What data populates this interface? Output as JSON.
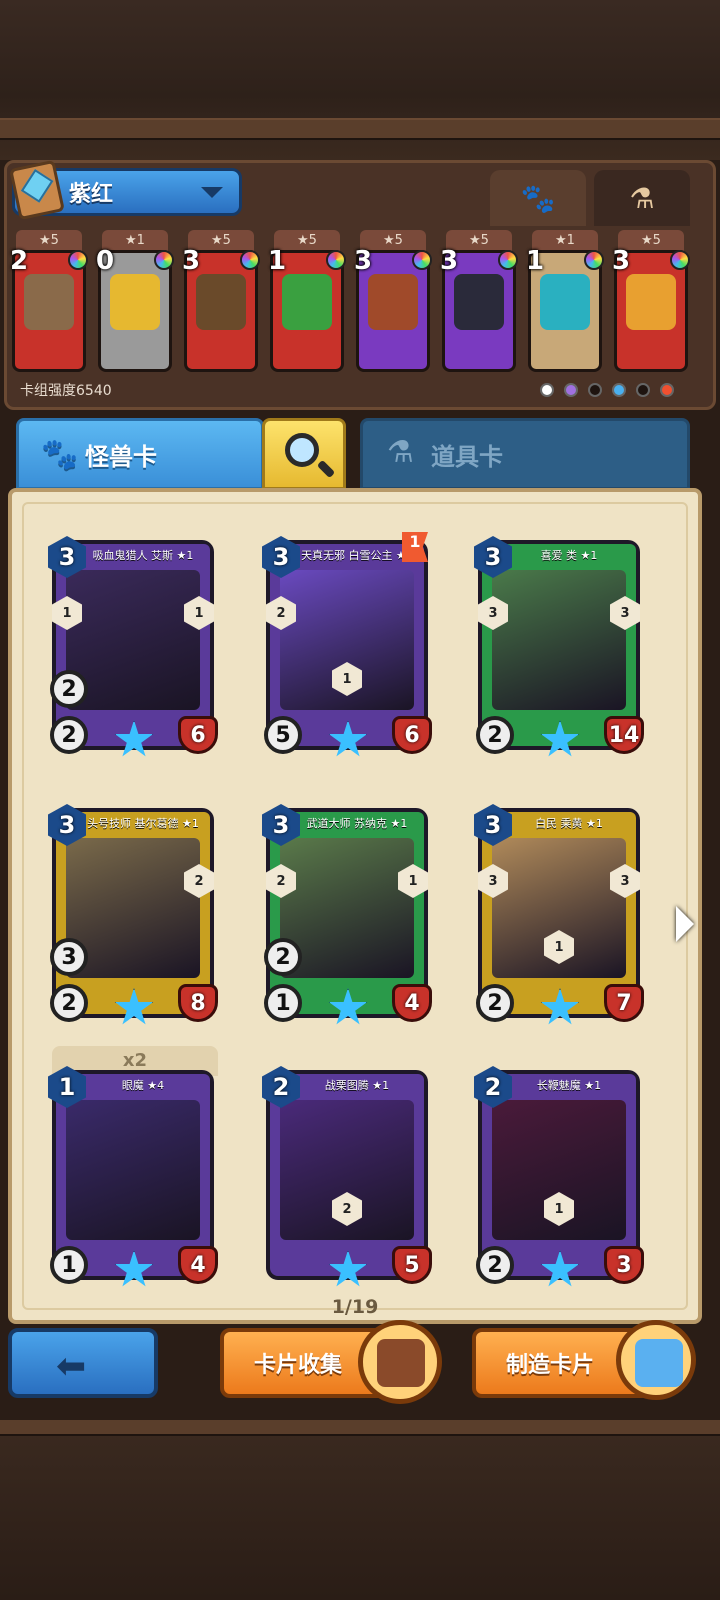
{
  "header": {
    "deck_name": "紫红",
    "top_tabs": [
      {
        "icon": "paw-icon",
        "active": false
      },
      {
        "icon": "potion-icon",
        "active": true
      }
    ]
  },
  "deck": {
    "strength_label": "卡组强度6540",
    "cards": [
      {
        "stars": "★5",
        "cost": "2",
        "frame_color": "#c8322a",
        "art_color": "#8a6a4a"
      },
      {
        "stars": "★1",
        "cost": "0",
        "frame_color": "#9a9a9a",
        "art_color": "#e6b830"
      },
      {
        "stars": "★5",
        "cost": "3",
        "frame_color": "#c8322a",
        "art_color": "#6a4a2a"
      },
      {
        "stars": "★5",
        "cost": "1",
        "frame_color": "#c8322a",
        "art_color": "#3aa040"
      },
      {
        "stars": "★5",
        "cost": "3",
        "frame_color": "#7a3ac0",
        "art_color": "#a04a2a"
      },
      {
        "stars": "★5",
        "cost": "3",
        "frame_color": "#7a3ac0",
        "art_color": "#2a2a3a"
      },
      {
        "stars": "★1",
        "cost": "1",
        "frame_color": "#c8a878",
        "art_color": "#2ab0c0"
      },
      {
        "stars": "★5",
        "cost": "3",
        "frame_color": "#c8322a",
        "art_color": "#e8a030"
      }
    ],
    "filter_colors": [
      "#ffffff",
      "#a070e0",
      "#1e1410",
      "#4ab0f0",
      "#1e1410",
      "#f05030"
    ]
  },
  "category_tabs": {
    "monster_label": "怪兽卡",
    "item_label": "道具卡"
  },
  "cards": [
    {
      "title": "吸血鬼猎人 艾斯 ★1",
      "cost": "3",
      "stat_a": "2",
      "stat_b": "2",
      "health": "6",
      "left_badge": "1",
      "right_badge": "1",
      "frame": "#5a3a9a",
      "art": "#3a2a5a"
    },
    {
      "title": "天真无邪 白雪公主 ★8",
      "cost": "3",
      "stat_a": "",
      "stat_b": "5",
      "health": "6",
      "left_badge": "2",
      "right_badge": "",
      "frame": "#5a3a9a",
      "art": "#6a4ac0",
      "flag": "1",
      "extra_badge": "1"
    },
    {
      "title": "喜爱 类 ★1",
      "cost": "3",
      "stat_a": "",
      "stat_b": "2",
      "health": "14",
      "left_badge": "3",
      "right_badge": "3",
      "frame": "#2a9a4a",
      "art": "#4a7a4a"
    },
    {
      "title": "头号技师 基尔葛德 ★1",
      "cost": "3",
      "stat_a": "3",
      "stat_b": "2",
      "health": "8",
      "left_badge": "",
      "right_badge": "2",
      "frame": "#c8a020",
      "art": "#7a6a4a"
    },
    {
      "title": "武道大师 苏纳克 ★1",
      "cost": "3",
      "stat_a": "2",
      "stat_b": "1",
      "health": "4",
      "left_badge": "2",
      "right_badge": "1",
      "frame": "#2a9a4a",
      "art": "#5a7a4a"
    },
    {
      "title": "白民 乘黄 ★1",
      "cost": "3",
      "stat_a": "",
      "stat_b": "2",
      "health": "7",
      "left_badge": "3",
      "right_badge": "3",
      "frame": "#c8a020",
      "art": "#b08a5a",
      "extra_badge": "1"
    },
    {
      "title": "眼魔 ★4",
      "cost": "1",
      "stat_a": "",
      "stat_b": "1",
      "health": "4",
      "left_badge": "",
      "right_badge": "",
      "frame": "#5a3a9a",
      "art": "#3a2a6a"
    },
    {
      "title": "战栗图腾 ★1",
      "cost": "2",
      "stat_a": "",
      "stat_b": "",
      "health": "5",
      "left_badge": "",
      "right_badge": "",
      "frame": "#5a3a9a",
      "art": "#4a2a7a",
      "extra_badge": "2"
    },
    {
      "title": "长鞭魅魔 ★1",
      "cost": "2",
      "stat_a": "",
      "stat_b": "2",
      "health": "3",
      "left_badge": "",
      "right_badge": "",
      "frame": "#5a3a9a",
      "art": "#4a1a3a",
      "extra_badge": "1"
    }
  ],
  "x2_label": "x2",
  "page_indicator": "1/19",
  "buttons": {
    "collect_label": "卡片收集",
    "craft_label": "制造卡片"
  }
}
